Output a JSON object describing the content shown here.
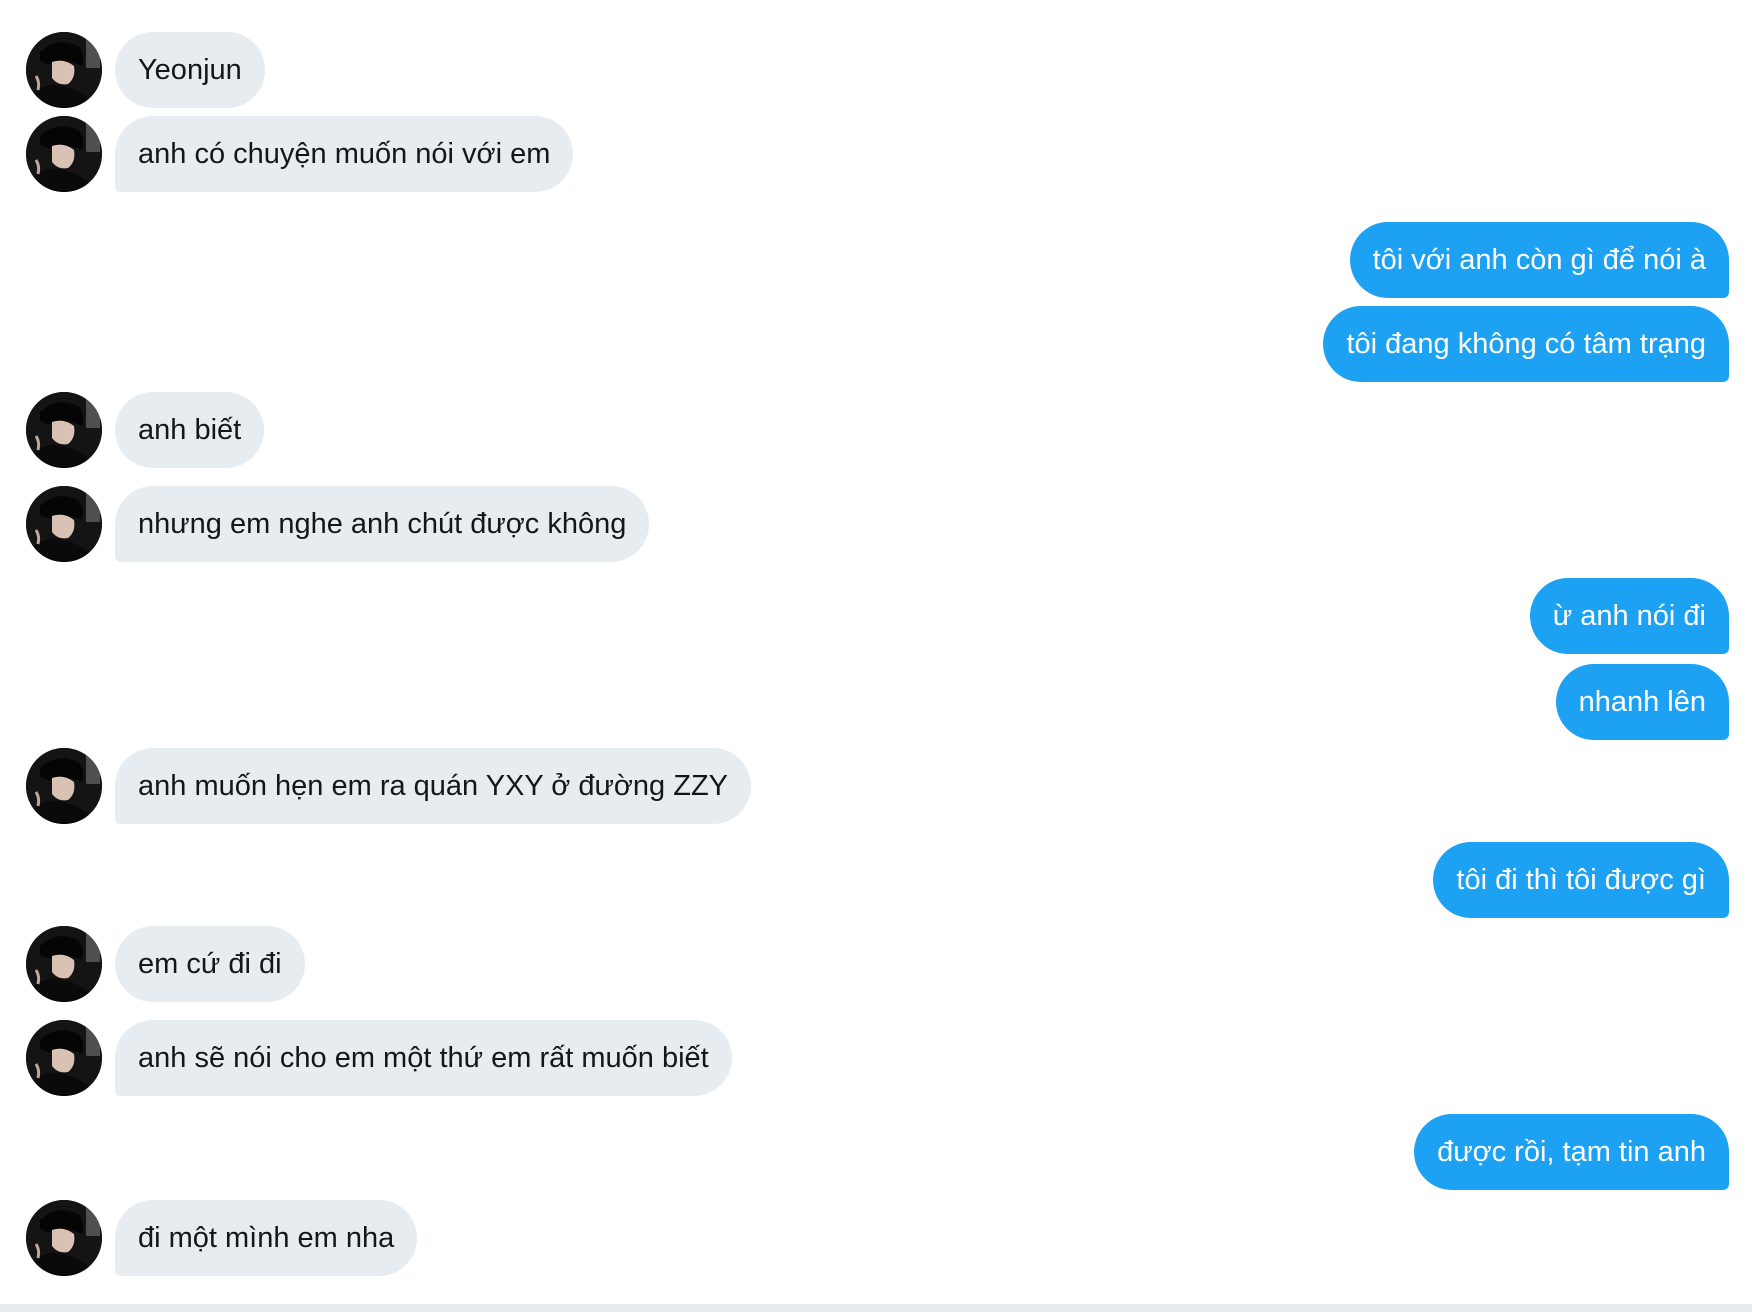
{
  "conversation": {
    "messages": [
      {
        "side": "in",
        "text": "Yeonjun"
      },
      {
        "side": "in",
        "text": "anh có chuyện muốn nói với em"
      },
      {
        "side": "out",
        "text": "tôi với anh còn gì để nói à"
      },
      {
        "side": "out",
        "text": "tôi đang không có tâm trạng"
      },
      {
        "side": "in",
        "text": "anh biết"
      },
      {
        "side": "in",
        "text": "nhưng em nghe anh chút được không"
      },
      {
        "side": "out",
        "text": "ừ anh nói đi"
      },
      {
        "side": "out",
        "text": "nhanh lên"
      },
      {
        "side": "in",
        "text": "anh muốn hẹn em ra quán YXY ở đường ZZY"
      },
      {
        "side": "out",
        "text": "tôi đi thì tôi được gì"
      },
      {
        "side": "in",
        "text": "em cứ đi đi"
      },
      {
        "side": "in",
        "text": "anh sẽ nói cho em một thứ em rất muốn biết"
      },
      {
        "side": "out",
        "text": "được rồi, tạm tin anh"
      },
      {
        "side": "in",
        "text": "đi một mình em nha"
      }
    ]
  },
  "colors": {
    "incoming_bubble": "#e6ecf0",
    "incoming_text": "#14171a",
    "outgoing_bubble": "#1da1f2",
    "outgoing_text": "#ffffff",
    "background": "#ffffff"
  },
  "icons": {
    "avatar": "profile-photo-avatar"
  }
}
